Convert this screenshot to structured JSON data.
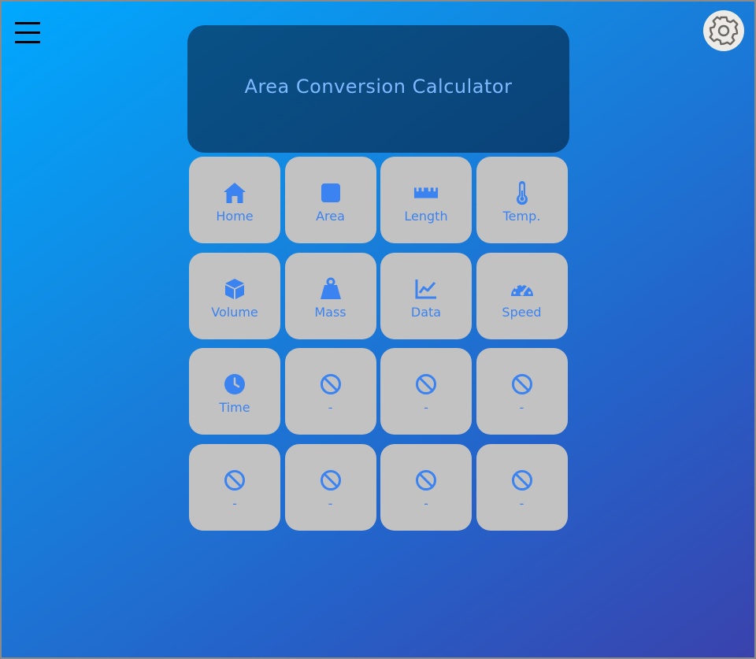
{
  "title": "Area Conversion Calculator",
  "colors": {
    "accent": "#3b83f0",
    "tile": "#c2c2c2",
    "panel": "#0a4a80",
    "title_text": "#7fb8ff"
  },
  "header": {
    "menu_icon": "hamburger-icon",
    "settings_icon": "gear-icon"
  },
  "tiles": [
    {
      "label": "Home",
      "icon": "home-icon"
    },
    {
      "label": "Area",
      "icon": "square-icon"
    },
    {
      "label": "Length",
      "icon": "ruler-icon"
    },
    {
      "label": "Temp.",
      "icon": "thermometer-icon"
    },
    {
      "label": "Volume",
      "icon": "cube-icon"
    },
    {
      "label": "Mass",
      "icon": "weight-icon"
    },
    {
      "label": "Data",
      "icon": "line-chart-icon"
    },
    {
      "label": "Speed",
      "icon": "speedometer-icon"
    },
    {
      "label": "Time",
      "icon": "clock-icon"
    },
    {
      "label": "-",
      "icon": "ban-icon"
    },
    {
      "label": "-",
      "icon": "ban-icon"
    },
    {
      "label": "-",
      "icon": "ban-icon"
    },
    {
      "label": "-",
      "icon": "ban-icon"
    },
    {
      "label": "-",
      "icon": "ban-icon"
    },
    {
      "label": "-",
      "icon": "ban-icon"
    },
    {
      "label": "-",
      "icon": "ban-icon"
    }
  ]
}
